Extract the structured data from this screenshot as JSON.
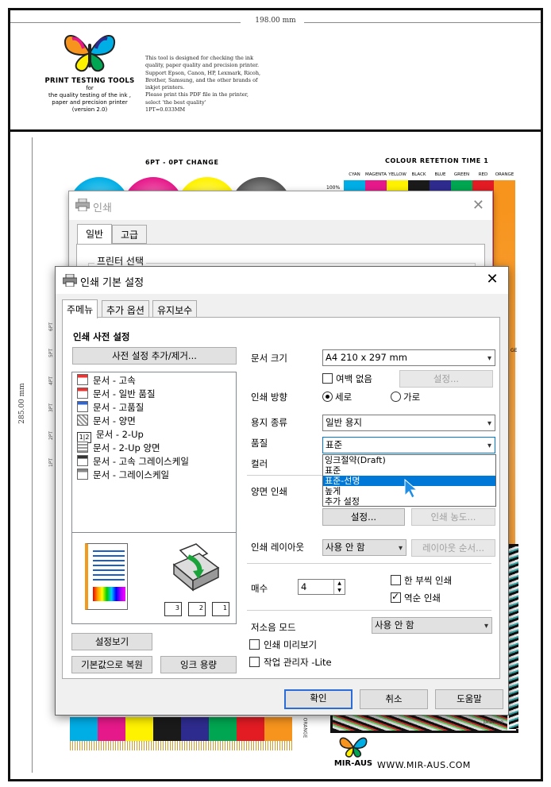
{
  "sheet": {
    "width_label": "198.00 mm",
    "height_label": "285.00 mm",
    "logo_title": "PRINT TESTING TOOLS",
    "logo_sub": [
      "for",
      "the quality testing of the ink ,",
      "paper  and precision printer",
      "(version 2.0)"
    ],
    "description": [
      "This tool is designed for checking the ink",
      "quality, paper quality and precision printer.",
      "Support Epson, Canon, HP, Lexmark, Ricoh,",
      "Brother, Samsung, and the other brands of",
      "inkjet printers.",
      "Please print this PDF file in the printer,",
      "select 'the best quality'",
      "1PT=0.033MM"
    ],
    "section_6pt": "6PT - 0PT CHANGE",
    "section_colour": "COLOUR RETETION TIME 1",
    "colour_headers": [
      "CYAN",
      "MAGENTA",
      "YELLOW",
      "BLACK",
      "BLUE",
      "GREEN",
      "RED",
      "ORANGE"
    ],
    "colour_hex": [
      "#00aee6",
      "#e6198a",
      "#fff200",
      "#1a1a1a",
      "#2e2b8f",
      "#00a651",
      "#e31b23",
      "#f7941d"
    ],
    "pct_label": "100%",
    "pt_labels": [
      "6PT",
      "5PT",
      "4PT",
      "3PT",
      "2PT",
      "1PT"
    ],
    "orange_label": "ORANGE",
    "drawing_label": "Drawing",
    "ge_label": "GE",
    "brand": "MIR-AUS",
    "url": "WWW.MIR-AUS.COM"
  },
  "print_dialog": {
    "title": "인쇄",
    "tabs": [
      "일반",
      "고급"
    ],
    "group_label": "프린터 선택"
  },
  "pref_dialog": {
    "title": "인쇄 기본 설정",
    "tabs": [
      "주메뉴",
      "추가 옵션",
      "유지보수"
    ],
    "preset_heading": "인쇄 사전 설정",
    "preset_button": "사전 설정 추가/제거...",
    "presets": [
      "문서 - 고속",
      "문서 - 일반 품질",
      "문서 - 고품질",
      "문서 - 양면",
      "문서 - 2-Up",
      "문서 - 2-Up 양면",
      "문서 - 고속 그레이스케일",
      "문서 - 그레이스케일"
    ],
    "copy_icons": [
      "3",
      "2",
      "1"
    ],
    "show_settings": "설정보기",
    "restore_defaults": "기본값으로 복원",
    "ink_levels": "잉크 용량",
    "paper_size_label": "문서 크기",
    "paper_size_value": "A4 210 x 297 mm",
    "borderless_label": "여백 없음",
    "borderless_settings": "설정...",
    "orientation_label": "인쇄 방향",
    "portrait": "세로",
    "landscape": "가로",
    "paper_type_label": "용지 종류",
    "paper_type_value": "일반 용지",
    "quality_label": "품질",
    "quality_value": "표준",
    "color_label": "컬러",
    "quality_options": [
      "잉크절약(Draft)",
      "표준",
      "표준-선명",
      "높게",
      "추가 설정"
    ],
    "quality_highlighted": "표준-선명",
    "duplex_label": "양면 인쇄",
    "duplex_settings": "설정...",
    "print_density": "인쇄 농도...",
    "layout_label": "인쇄 레이아웃",
    "layout_value": "사용 안 함",
    "layout_order": "레이아웃 순서...",
    "copies_label": "매수",
    "copies_value": "4",
    "collate_label": "한 부씩 인쇄",
    "reverse_label": "역순 인쇄",
    "quiet_label": "저소음 모드",
    "quiet_value": "사용 안 함",
    "preview_label": "인쇄 미리보기",
    "job_manager_label": "작업 관리자 -Lite",
    "ok": "확인",
    "cancel": "취소",
    "help": "도움말"
  }
}
